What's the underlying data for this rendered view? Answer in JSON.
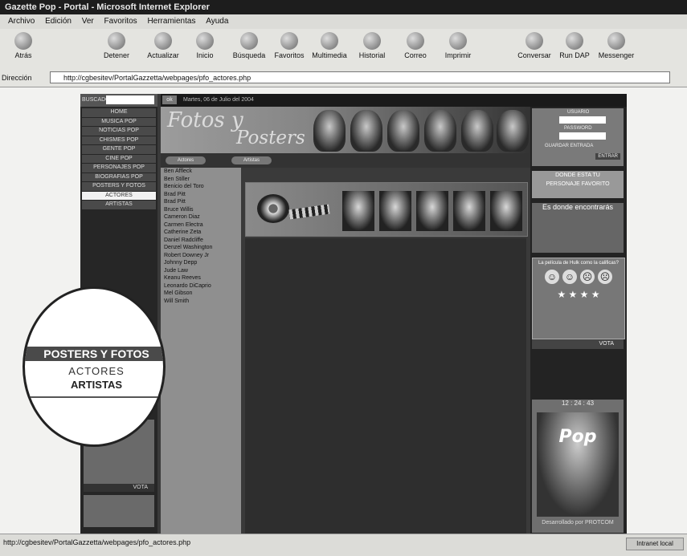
{
  "window": {
    "title": "Gazette Pop - Portal - Microsoft Internet Explorer"
  },
  "menu": [
    "Archivo",
    "Edición",
    "Ver",
    "Favoritos",
    "Herramientas",
    "Ayuda"
  ],
  "toolbar": [
    "Atrás",
    "Detener",
    "Actualizar",
    "Inicio",
    "Búsqueda",
    "Favoritos",
    "Multimedia",
    "Historial",
    "Correo",
    "Imprimir",
    "Conversar",
    "Run DAP",
    "Messenger"
  ],
  "address": {
    "label": "Dirección",
    "url": "http://cgbesitev/PortalGazzetta/webpages/pfo_actores.php"
  },
  "site": {
    "search_label": "BUSCADOR",
    "go_label": "ok",
    "date": "Martes, 06 de Julio del 2004",
    "nav": [
      "HOME",
      "MUSICA POP",
      "NOTICIAS POP",
      "CHISMES POP",
      "GENTE POP",
      "CINE POP",
      "PERSONAJES POP",
      "BIOGRAFIAS POP",
      "POSTERS Y FOTOS",
      "ACTORES",
      "ARTISTAS"
    ],
    "banner": {
      "line1": "Fotos y",
      "line2": "Posters"
    },
    "tabs": [
      "Actores",
      "Artistas"
    ],
    "actors": [
      "Ben Affleck",
      "Ben Stiller",
      "Benicio del Toro",
      "Brad Pitt",
      "Brad Pitt",
      "Bruce Willis",
      "Cameron Diaz",
      "Carmen Electra",
      "Catherine Zeta",
      "Daniel Radcliffe",
      "Denzel Washington",
      "Robert Downey Jr",
      "Johnny Depp",
      "Jude Law",
      "Keanu Reeves",
      "Leonardo DiCaprio",
      "Mel Gibson",
      "Will Smith"
    ],
    "login": {
      "user_label": "USUARIO",
      "pass_label": "PASSWORD",
      "remember_label": "GUARDAR ENTRADA",
      "enter_label": "ENTRAR"
    },
    "promo": {
      "line1": "DONDE ESTA TU",
      "line2": "PERSONAJE FAVORITO"
    },
    "find": "Es donde encontrarás",
    "poll": {
      "question": "La película de Hulk como la calificas?",
      "vote": "VOTA"
    },
    "left_poll": {
      "question": "Qué es el nombre de esta peli?",
      "vote": "VOTA"
    },
    "clock": "12 : 24 : 43",
    "cover_text": "Pop",
    "developer": "Desarrollado por PROTCOM"
  },
  "magnifier": {
    "item1": "POSTERS Y FOTOS",
    "item2": "ACTORES",
    "item3": "ARTISTAS"
  },
  "status": {
    "url": "http://cgbesitev/PortalGazzetta/webpages/pfo_actores.php",
    "zone": "Intranet local"
  }
}
